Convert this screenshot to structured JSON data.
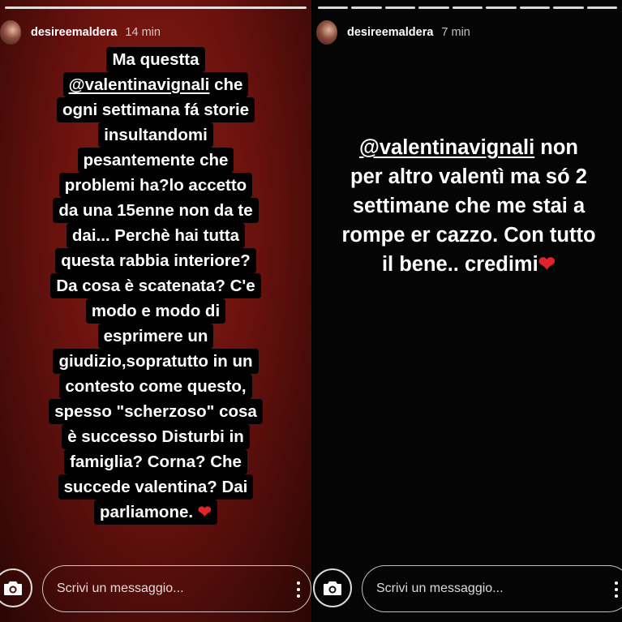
{
  "left_story": {
    "progress_segments": 1,
    "username": "desireemaldera",
    "time": "14 min",
    "mention": "@valentinavignali",
    "lines": [
      "Ma questta",
      "@valentinavignali  che",
      "ogni settimana fá storie",
      "insultandomi",
      "pesantemente che",
      "problemi ha?lo accetto",
      "da una 15enne non da te",
      "dai...  Perchè hai tutta",
      "questa rabbia interiore?",
      "Da cosa è scatenata? C'e",
      "modo e modo di",
      "esprimere un",
      "giudizio,sopratutto in un",
      "contesto come questo,",
      "spesso \"scherzoso\" cosa",
      "è successo Disturbi in",
      "famiglia? Corna? Che",
      "succede valentina? Dai",
      "parliamone. ❤️"
    ],
    "message_placeholder": "Scrivi un messaggio...",
    "camera_icon": "camera-icon",
    "more_icon": "more-vertical-icon"
  },
  "right_story": {
    "progress_segments": 9,
    "username": "desireemaldera",
    "time": "7 min",
    "mention": "@valentinavignali",
    "lines": [
      "@valentinavignali  non",
      "per altro valentì ma só 2",
      "settimane che me stai a",
      "rompe er cazzo. Con tutto",
      "il bene.. credimi❤️"
    ],
    "message_placeholder": "Scrivi un messaggio...",
    "camera_icon": "camera-icon",
    "more_icon": "more-vertical-icon"
  },
  "colors": {
    "left_background": "#8c1b14",
    "right_background": "#050505",
    "heart": "#e2232b",
    "text": "#ffffff"
  }
}
